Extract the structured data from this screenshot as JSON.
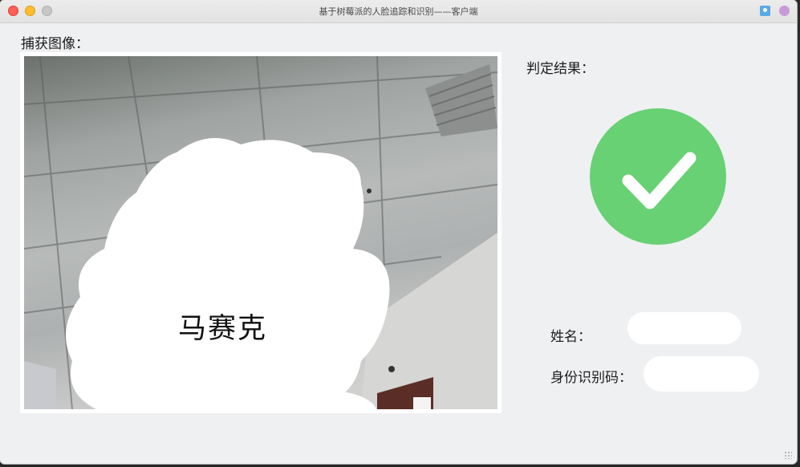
{
  "window": {
    "title": "基于树莓派的人脸追踪和识别——客户端"
  },
  "capture": {
    "label": "捕获图像：",
    "recognized_name": "马赛克"
  },
  "result": {
    "label": "判定结果：",
    "status": "recognized",
    "status_icon": "check-icon",
    "status_color": "#67d173"
  },
  "fields": {
    "name_label": "姓名：",
    "name_value": "",
    "id_label": "身份识别码：",
    "id_value": ""
  }
}
